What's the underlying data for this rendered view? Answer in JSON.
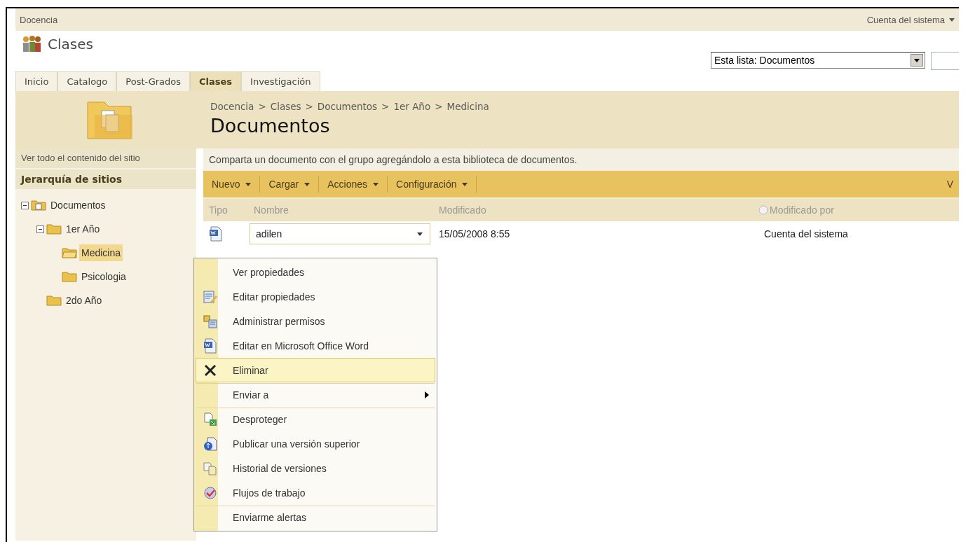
{
  "top_bar": {
    "site": "Docencia",
    "user": "Cuenta del sistema"
  },
  "site_title": "Clases",
  "search": {
    "scope": "Esta lista: Documentos"
  },
  "tabs": [
    {
      "label": "Inicio",
      "selected": false
    },
    {
      "label": "Catalogo",
      "selected": false
    },
    {
      "label": "Post-Grados",
      "selected": false
    },
    {
      "label": "Clases",
      "selected": true
    },
    {
      "label": "Investigación",
      "selected": false
    }
  ],
  "breadcrumb": [
    "Docencia",
    "Clases",
    "Documentos",
    "1er Año",
    "Medicina"
  ],
  "breadcrumb_separator": ">",
  "page_title": "Documentos",
  "sidebar": {
    "view_all": "Ver todo el contenido del sitio",
    "heading": "Jerarquía de sitios",
    "tree": [
      {
        "label": "Documentos",
        "kind": "library",
        "expanded": true,
        "selected": false,
        "children": [
          {
            "label": "1er Año",
            "kind": "folder",
            "expanded": true,
            "selected": false,
            "children": [
              {
                "label": "Medicina",
                "kind": "folder",
                "selected": true
              },
              {
                "label": "Psicologia",
                "kind": "folder",
                "selected": false
              }
            ]
          },
          {
            "label": "2do Año",
            "kind": "folder",
            "selected": false
          }
        ]
      }
    ]
  },
  "description": "Comparta un documento con el grupo agregándolo a esta biblioteca de documentos.",
  "toolbar": {
    "menus": [
      {
        "label": "Nuevo"
      },
      {
        "label": "Cargar"
      },
      {
        "label": "Acciones"
      },
      {
        "label": "Configuración"
      }
    ],
    "view_cut": "V"
  },
  "table": {
    "columns": [
      "Tipo",
      "Nombre",
      "Modificado",
      "Modificado por"
    ],
    "rows": [
      {
        "name": "adilen",
        "modified": "15/05/2008 8:55",
        "modified_by": "Cuenta del sistema"
      }
    ]
  },
  "context_menu": [
    {
      "label": "Ver propiedades",
      "kind": "plain",
      "highlighted": false,
      "separator_before": false,
      "submenu": false
    },
    {
      "label": "Editar propiedades",
      "kind": "edit",
      "highlighted": false,
      "separator_before": false,
      "submenu": false
    },
    {
      "label": "Administrar permisos",
      "kind": "permissions",
      "highlighted": false,
      "separator_before": false,
      "submenu": false
    },
    {
      "label": "Editar en Microsoft Office Word",
      "kind": "word",
      "highlighted": false,
      "separator_before": false,
      "submenu": false
    },
    {
      "label": "Eliminar",
      "kind": "delete",
      "highlighted": true,
      "separator_before": false,
      "submenu": false
    },
    {
      "label": "Enviar a",
      "kind": "plain",
      "highlighted": false,
      "separator_before": true,
      "submenu": true
    },
    {
      "label": "Desproteger",
      "kind": "checkin",
      "highlighted": false,
      "separator_before": true,
      "submenu": false
    },
    {
      "label": "Publicar una versión superior",
      "kind": "publish",
      "highlighted": false,
      "separator_before": false,
      "submenu": false
    },
    {
      "label": "Historial de versiones",
      "kind": "history",
      "highlighted": false,
      "separator_before": false,
      "submenu": false
    },
    {
      "label": "Flujos de trabajo",
      "kind": "workflow",
      "highlighted": false,
      "separator_before": false,
      "submenu": false
    },
    {
      "label": "Enviarme alertas",
      "kind": "plain",
      "highlighted": false,
      "separator_before": true,
      "submenu": false
    }
  ]
}
